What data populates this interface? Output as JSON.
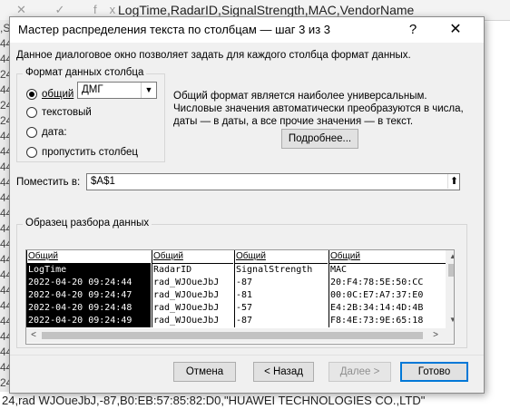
{
  "excel": {
    "formula_bar_icons": "✕ ✓ fx",
    "formula_text": "LogTime,RadarID,SignalStrength,MAC,VendorName",
    "row_hints": [
      ",S",
      "44",
      "44",
      "24",
      "44",
      "24",
      "24",
      "44",
      "44",
      "44",
      "44",
      "44",
      "44",
      "44",
      "44",
      "44",
      "44",
      "44",
      "44",
      "44",
      "44",
      "44",
      "44",
      "24"
    ],
    "bottom_line": "24,rad  WJOueJbJ,-87,B0:EB:57:85:82:D0,\"HUAWEI TECHNOLOGIES CO.,LTD\""
  },
  "dialog": {
    "title": "Мастер распределения текста по столбцам — шаг 3 из 3",
    "help": "?",
    "close": "✕",
    "intro": "Данное диалоговое окно позволяет задать для каждого столбца формат данных.",
    "format_group": {
      "legend": "Формат данных столбца",
      "options": [
        {
          "label": "общий",
          "checked": true
        },
        {
          "label": "текстовый",
          "checked": false
        },
        {
          "label": "дата:",
          "checked": false
        },
        {
          "label": "пропустить столбец",
          "checked": false
        }
      ],
      "date_value": "ДМГ"
    },
    "general_description": "Общий формат является наиболее универсальным. Числовые значения автоматически преобразуются в числа, даты — в даты, а все прочие значения — в текст.",
    "details_button": "Подробнее...",
    "destination": {
      "label": "Поместить в:",
      "value": "$A$1"
    },
    "preview": {
      "legend": "Образец разбора данных",
      "columns": [
        {
          "header": "Общий",
          "cells": [
            "LogTime",
            "2022-04-20 09:24:44",
            "2022-04-20 09:24:47",
            "2022-04-20 09:24:48",
            "2022-04-20 09:24:49"
          ]
        },
        {
          "header": "Общий",
          "cells": [
            "RadarID",
            "rad_WJOueJbJ",
            "rad_WJOueJbJ",
            "rad_WJOueJbJ",
            "rad_WJOueJbJ"
          ]
        },
        {
          "header": "Общий",
          "cells": [
            "SignalStrength",
            "-87",
            "-81",
            "-57",
            "-87"
          ]
        },
        {
          "header": "Общий",
          "cells": [
            "MAC",
            "20:F4:78:5E:50:CC",
            "00:0C:E7:A7:37:E0",
            "E4:2B:34:14:4D:4B",
            "F8:4E:73:9E:65:18"
          ]
        }
      ]
    },
    "buttons": {
      "cancel": "Отмена",
      "back": "< Назад",
      "next": "Далее >",
      "finish": "Готово"
    }
  }
}
